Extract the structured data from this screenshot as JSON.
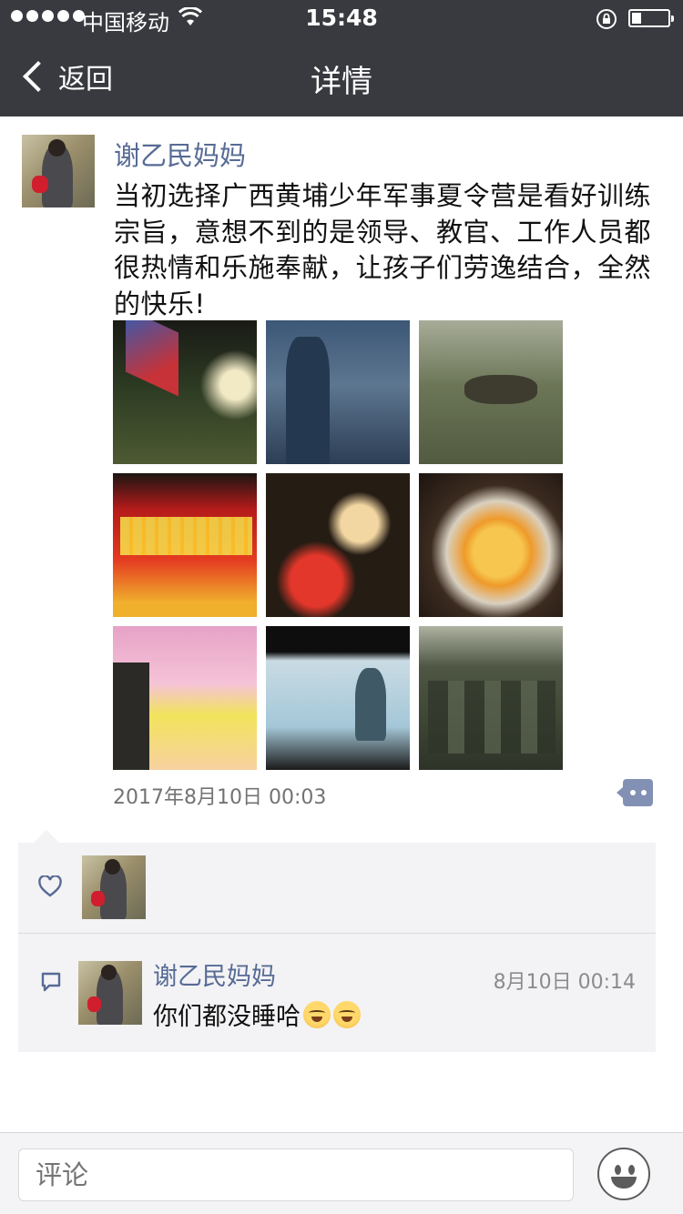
{
  "status_bar": {
    "carrier": "中国移动",
    "time": "15:48"
  },
  "nav": {
    "back_label": "返回",
    "title": "详情"
  },
  "post": {
    "author": "谢乙民妈妈",
    "text": "当初选择广西黄埔少年军事夏令营是看好训练宗旨，意想不到的是领导、教官、工作人员都很热情和乐施奉献，让孩子们劳逸结合，全然的快乐!",
    "photos": [
      {
        "name": "photo-flag-ceremony"
      },
      {
        "name": "photo-cadets-line"
      },
      {
        "name": "photo-crawling-drill"
      },
      {
        "name": "photo-graduation-screen"
      },
      {
        "name": "photo-birthday-cakes"
      },
      {
        "name": "photo-fruit-cake"
      },
      {
        "name": "photo-birthday-banner"
      },
      {
        "name": "photo-birthday-screen"
      },
      {
        "name": "photo-cadets-seated"
      }
    ],
    "timestamp": "2017年8月10日 00:03",
    "link_color": "#576b95"
  },
  "likes": {
    "icon": "heart-icon"
  },
  "comments": [
    {
      "author": "谢乙民妈妈",
      "time": "8月10日 00:14",
      "text": "你们都没睡哈"
    }
  ],
  "composer": {
    "placeholder": "评论",
    "emoji_icon": "smiley-icon"
  }
}
